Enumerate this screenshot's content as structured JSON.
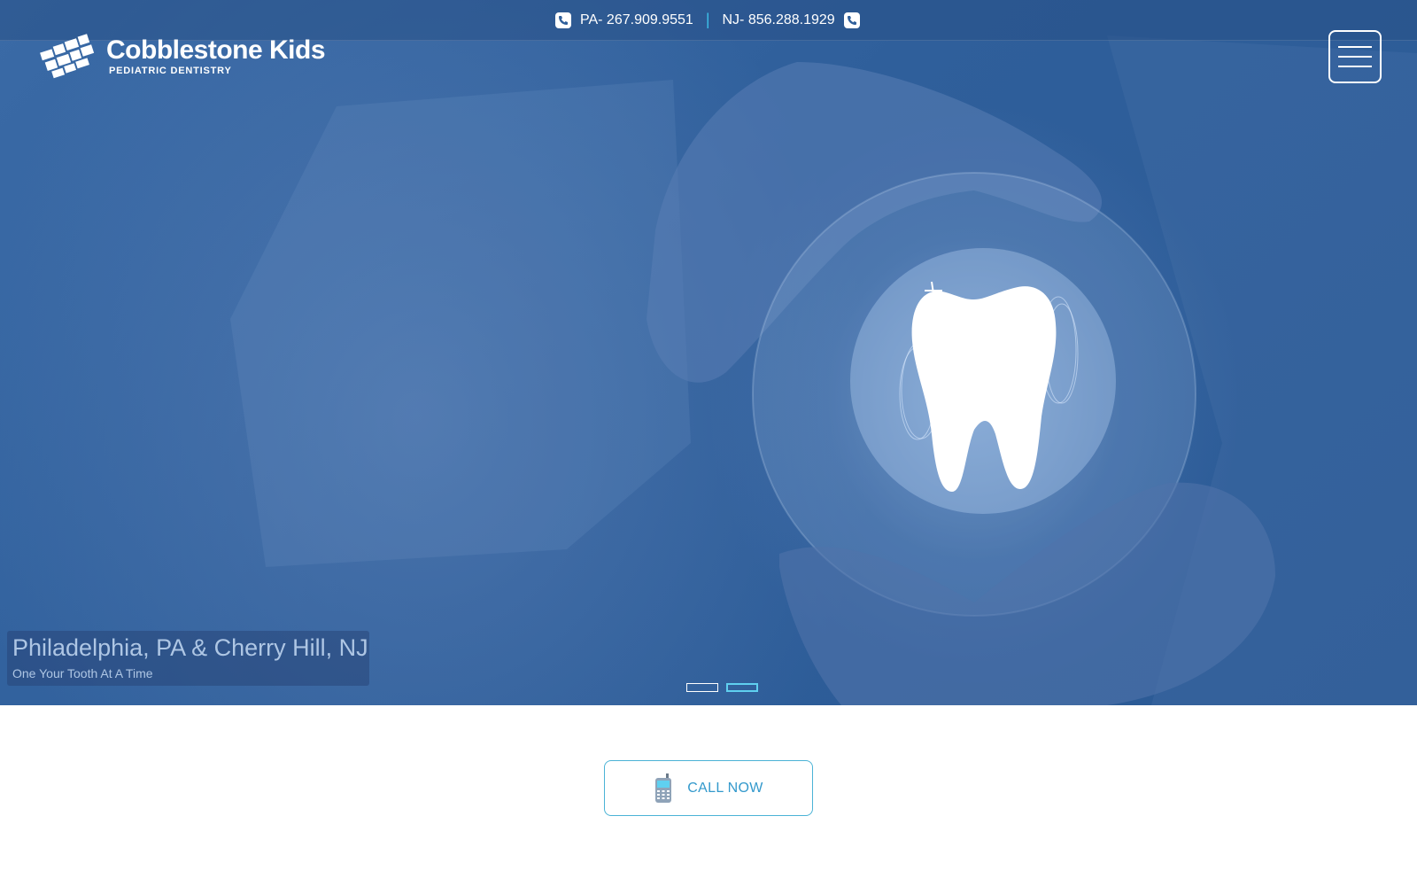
{
  "topbar": {
    "pa_phone": "PA- 267.909.9551",
    "separator": "|",
    "nj_phone": "NJ- 856.288.1929"
  },
  "logo": {
    "title": "Cobblestone Kids",
    "subtitle": "PEDIATRIC DENTISTRY"
  },
  "hero": {
    "caption_title": "Philadelphia, PA & Cherry Hill, NJ",
    "caption_subtitle": "One Your Tooth At A Time",
    "slides": 2,
    "active_slide": 2
  },
  "cta": {
    "label": "CALL NOW"
  },
  "icons": [
    "phone-icon",
    "menu-icon",
    "tooth-icon",
    "mobile-phone-icon"
  ],
  "colors": {
    "hero_blue": "#2f5f9b",
    "accent_cyan": "#3cc0e8",
    "cta_text": "#3399cc"
  }
}
